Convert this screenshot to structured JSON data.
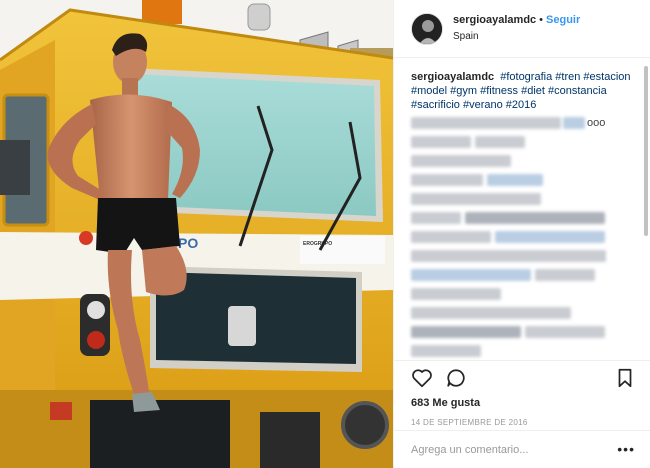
{
  "post": {
    "username": "sergioayalamdc",
    "separator": "•",
    "follow_label": "Seguir",
    "location": "Spain",
    "photo_sign_text": "EROGRUPO",
    "photo_window_brand": "PO"
  },
  "caption": {
    "username": "sergioayalamdc",
    "hashtags": [
      "#fotografia",
      "#tren",
      "#estacion",
      "#model",
      "#gym",
      "#fitness",
      "#diet",
      "#constancia",
      "#sacrificio",
      "#verano",
      "#2016"
    ],
    "visible_tail": "ooo"
  },
  "actions": {
    "like_icon": "heart-icon",
    "comment_icon": "comment-icon",
    "save_icon": "bookmark-icon",
    "likes_text": "683 Me gusta",
    "date_text": "14 DE SEPTIEMBRE DE 2016"
  },
  "comment_box": {
    "placeholder": "Agrega un comentario...",
    "more_label": "•••"
  },
  "colors": {
    "link": "#3897f0",
    "hashtag": "#003569",
    "border": "#efefef",
    "train_yellow": "#e8b52a",
    "window_teal": "#9fd3cf"
  }
}
